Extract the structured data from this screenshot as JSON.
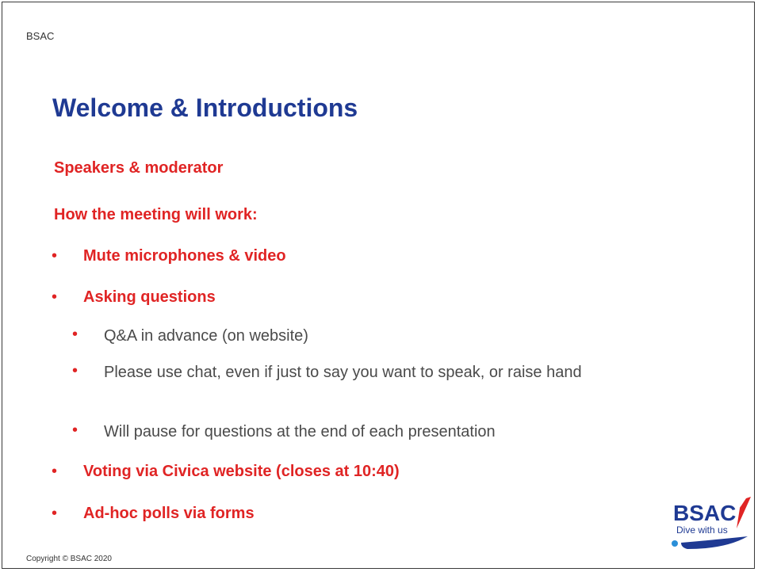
{
  "header": {
    "org_label": "BSAC"
  },
  "slide": {
    "title": "Welcome & Introductions",
    "headings": [
      "Speakers & moderator",
      "How the meeting will work:"
    ],
    "bullets": [
      {
        "text": "Mute microphones & video"
      },
      {
        "text": "Asking questions"
      },
      {
        "text": "Voting via Civica website (closes at 10:40)"
      },
      {
        "text": "Ad-hoc polls via forms"
      }
    ],
    "sub_bullets": [
      {
        "text": "Q&A in advance (on website)"
      },
      {
        "text": "Please use chat, even if just to say you want to speak, or raise hand"
      },
      {
        "text": "Will pause for questions at the end of each presentation"
      }
    ],
    "bullet_glyph": "•"
  },
  "footer": {
    "copyright": "Copyright © BSAC 2020"
  },
  "logo": {
    "name": "BSAC",
    "tagline": "Dive with us"
  },
  "colors": {
    "title": "#1f3a93",
    "accent_red": "#e02424",
    "body_gray": "#4a4a4a",
    "logo_navy": "#1f3a93"
  }
}
